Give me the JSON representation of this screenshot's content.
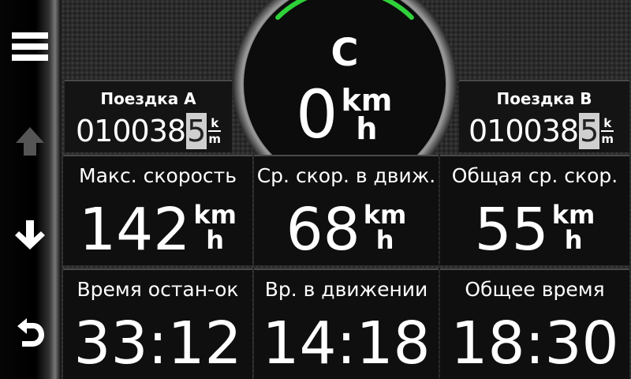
{
  "sidebar": {
    "menu_icon": "hamburger-menu-icon",
    "up_icon": "arrow-up-icon",
    "down_icon": "arrow-down-icon",
    "back_icon": "back-arrow-icon"
  },
  "trip_a": {
    "title": "Поездка A",
    "digits": "010038",
    "last_digit": "5",
    "unit_top": "k",
    "unit_bottom": "m"
  },
  "trip_b": {
    "title": "Поездка B",
    "digits": "010038",
    "last_digit": "5",
    "unit_top": "k",
    "unit_bottom": "m"
  },
  "speedometer": {
    "heading": "C",
    "speed": "0",
    "unit_top": "km",
    "unit_bottom": "h"
  },
  "stats": [
    {
      "label": "Макс. скорость",
      "value": "142",
      "unit_top": "km",
      "unit_bottom": "h"
    },
    {
      "label": "Ср. скор. в движ.",
      "value": "68",
      "unit_top": "km",
      "unit_bottom": "h"
    },
    {
      "label": "Общая ср. скор.",
      "value": "55",
      "unit_top": "km",
      "unit_bottom": "h"
    }
  ],
  "times": [
    {
      "label": "Время остан-ок",
      "value": "33:12"
    },
    {
      "label": "Вр. в движении",
      "value": "14:18"
    },
    {
      "label": "Общее время",
      "value": "18:30"
    }
  ],
  "colors": {
    "gauge_arc": "#2fd13a",
    "odo_highlight": "#cfcfcf"
  }
}
